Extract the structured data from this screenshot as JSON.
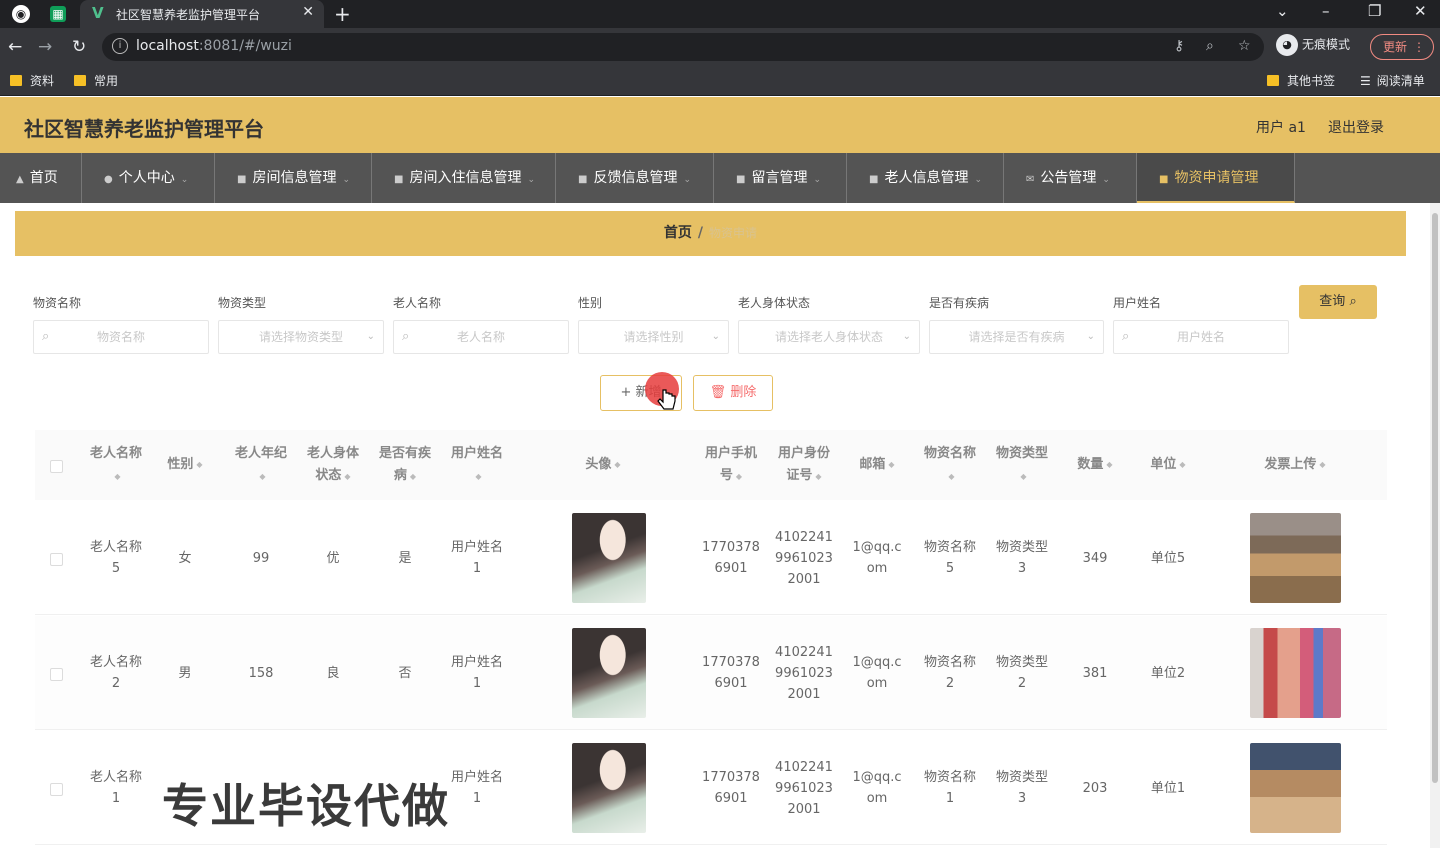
{
  "browser": {
    "tab_title": "社区智慧养老监护管理平台",
    "url_host": "localhost",
    "url_rest": ":8081/#/wuzi",
    "incognito_label": "无痕模式",
    "update_label": "更新",
    "bookmarks": [
      "资料",
      "常用"
    ],
    "other_bookmarks": "其他书签",
    "reading_list": "阅读清单"
  },
  "header": {
    "title": "社区智慧养老监护管理平台",
    "user": "用户 a1",
    "logout": "退出登录"
  },
  "menu": [
    {
      "icon": "home-icon",
      "label": "首页"
    },
    {
      "icon": "user-icon",
      "label": "个人中心"
    },
    {
      "icon": "room-icon",
      "label": "房间信息管理"
    },
    {
      "icon": "checkin-icon",
      "label": "房间入住信息管理"
    },
    {
      "icon": "feedback-icon",
      "label": "反馈信息管理"
    },
    {
      "icon": "message-icon",
      "label": "留言管理"
    },
    {
      "icon": "elder-icon",
      "label": "老人信息管理"
    },
    {
      "icon": "notice-icon",
      "label": "公告管理"
    },
    {
      "icon": "supply-icon",
      "label": "物资申请管理"
    }
  ],
  "breadcrumb": {
    "home": "首页",
    "sep": "/",
    "current": "物资申请"
  },
  "search": {
    "fields": [
      {
        "label": "物资名称",
        "placeholder": "物资名称"
      },
      {
        "label": "物资类型",
        "placeholder": "请选择物资类型"
      },
      {
        "label": "老人名称",
        "placeholder": "老人名称"
      },
      {
        "label": "性别",
        "placeholder": "请选择性别"
      },
      {
        "label": "老人身体状态",
        "placeholder": "请选择老人身体状态"
      },
      {
        "label": "是否有疾病",
        "placeholder": "请选择是否有疾病"
      },
      {
        "label": "用户姓名",
        "placeholder": "用户姓名"
      }
    ],
    "query_label": "查询"
  },
  "actions": {
    "add_label": "新增",
    "delete_label": "删除"
  },
  "table": {
    "columns": [
      [
        "老人名称"
      ],
      [
        "性别"
      ],
      [
        "老人年纪"
      ],
      [
        "老人身体",
        "状态"
      ],
      [
        "是否有疾",
        "病"
      ],
      [
        "用户姓名"
      ],
      [
        "头像"
      ],
      [
        "用户手机",
        "号"
      ],
      [
        "用户身份",
        "证号"
      ],
      [
        "邮箱"
      ],
      [
        "物资名称"
      ],
      [
        "物资类型"
      ],
      [
        "数量"
      ],
      [
        "单位"
      ],
      [
        "发票上传"
      ]
    ],
    "rows": [
      {
        "elder": [
          "老人名称",
          "5"
        ],
        "gender": "女",
        "age": "99",
        "status": "优",
        "disease": "是",
        "user": [
          "用户姓名",
          "1"
        ],
        "phone": [
          "1770378",
          "6901"
        ],
        "idno": [
          "4102241",
          "9961023",
          "2001"
        ],
        "email": [
          "1@qq.c",
          "om"
        ],
        "goods": [
          "物资名称",
          "5"
        ],
        "gtype": [
          "物资类型",
          "3"
        ],
        "qty": "349",
        "unit": "单位5"
      },
      {
        "elder": [
          "老人名称",
          "2"
        ],
        "gender": "男",
        "age": "158",
        "status": "良",
        "disease": "否",
        "user": [
          "用户姓名",
          "1"
        ],
        "phone": [
          "1770378",
          "6901"
        ],
        "idno": [
          "4102241",
          "9961023",
          "2001"
        ],
        "email": [
          "1@qq.c",
          "om"
        ],
        "goods": [
          "物资名称",
          "2"
        ],
        "gtype": [
          "物资类型",
          "2"
        ],
        "qty": "381",
        "unit": "单位2"
      },
      {
        "elder": [
          "老人名称",
          "1"
        ],
        "gender": "",
        "age": "",
        "status": "",
        "disease": "",
        "user": [
          "用户姓名",
          "1"
        ],
        "phone": [
          "1770378",
          "6901"
        ],
        "idno": [
          "4102241",
          "9961023",
          "2001"
        ],
        "email": [
          "1@qq.c",
          "om"
        ],
        "goods": [
          "物资名称",
          "1"
        ],
        "gtype": [
          "物资类型",
          "3"
        ],
        "qty": "203",
        "unit": "单位1"
      }
    ]
  },
  "watermark": "专业毕设代做"
}
